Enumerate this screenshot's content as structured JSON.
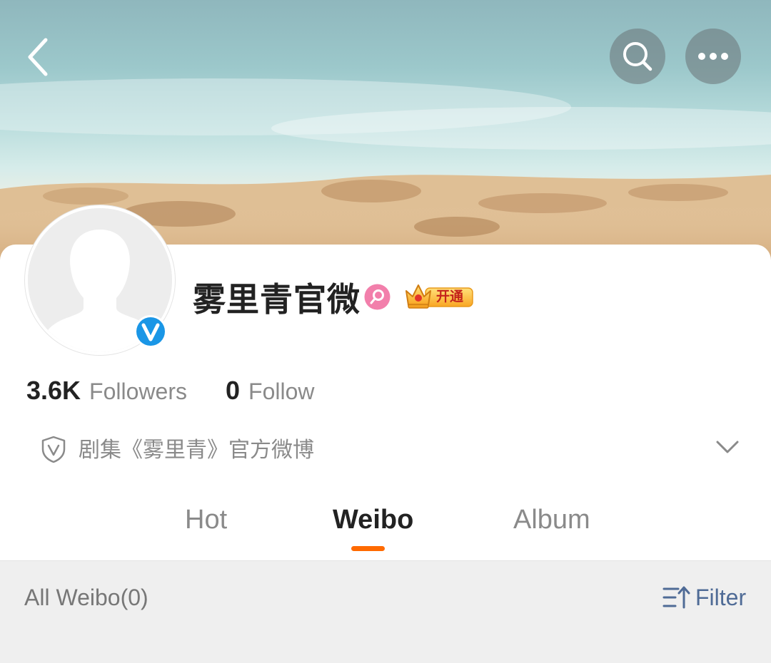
{
  "header": {
    "back_icon": "chevron-left-icon",
    "search_icon": "search-icon",
    "more_icon": "more-horizontal-icon",
    "cover_image": "beach-sand-sea-banner"
  },
  "profile": {
    "name": "雾里青官微",
    "avatar": "default-avatar-silhouette",
    "verified_icon": "verified-v-icon",
    "badge_icon": "pink-search-badge-icon",
    "vip_icon": "crown-icon",
    "vip_label": "开通",
    "followers_count": "3.6K",
    "followers_label": "Followers",
    "follow_count": "0",
    "follow_label": "Follow",
    "description": "剧集《雾里青》官方微博",
    "description_icon": "shield-v-icon",
    "expand_icon": "chevron-down-icon"
  },
  "tabs": [
    {
      "label": "Hot",
      "active": false
    },
    {
      "label": "Weibo",
      "active": true
    },
    {
      "label": "Album",
      "active": false
    }
  ],
  "list_header": {
    "title": "All Weibo(0)",
    "filter_label": "Filter",
    "filter_icon": "filter-sort-icon"
  },
  "colors": {
    "accent": "#ff6a00",
    "filter_text": "#4f6b96",
    "verified_blue": "#1a96e6",
    "secondary_text": "#8a8a8a",
    "primary_text": "#222222",
    "list_background": "#efefef"
  }
}
